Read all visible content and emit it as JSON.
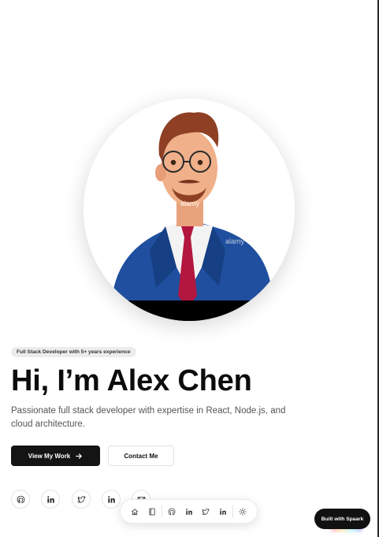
{
  "hero": {
    "badge": "Full Stack Developer with 5+ years experience",
    "title": "Hi, I’m Alex Chen",
    "subtitle": "Passionate full stack developer with expertise in React, Node.js, and cloud architecture.",
    "avatar_watermark": "alamy"
  },
  "actions": {
    "primary_label": "View My Work",
    "primary_icon": "arrow-right-icon",
    "secondary_label": "Contact Me"
  },
  "social_links": [
    {
      "icon": "github-icon"
    },
    {
      "icon": "linkedin-icon"
    },
    {
      "icon": "twitter-icon"
    },
    {
      "icon": "linkedin-icon"
    },
    {
      "icon": "mail-icon"
    }
  ],
  "dock": {
    "items": [
      {
        "icon": "home-icon"
      },
      {
        "icon": "notebook-icon"
      },
      {
        "icon": "github-icon"
      },
      {
        "icon": "linkedin-icon"
      },
      {
        "icon": "twitter-icon"
      },
      {
        "icon": "linkedin-icon"
      },
      {
        "icon": "sun-icon"
      }
    ]
  },
  "built_with": "Built with Spaark",
  "colors": {
    "accent": "#141414",
    "text_muted": "#555555",
    "badge_bg": "#ececec",
    "suit": "#1f4f9e",
    "tie": "#b3163e"
  }
}
